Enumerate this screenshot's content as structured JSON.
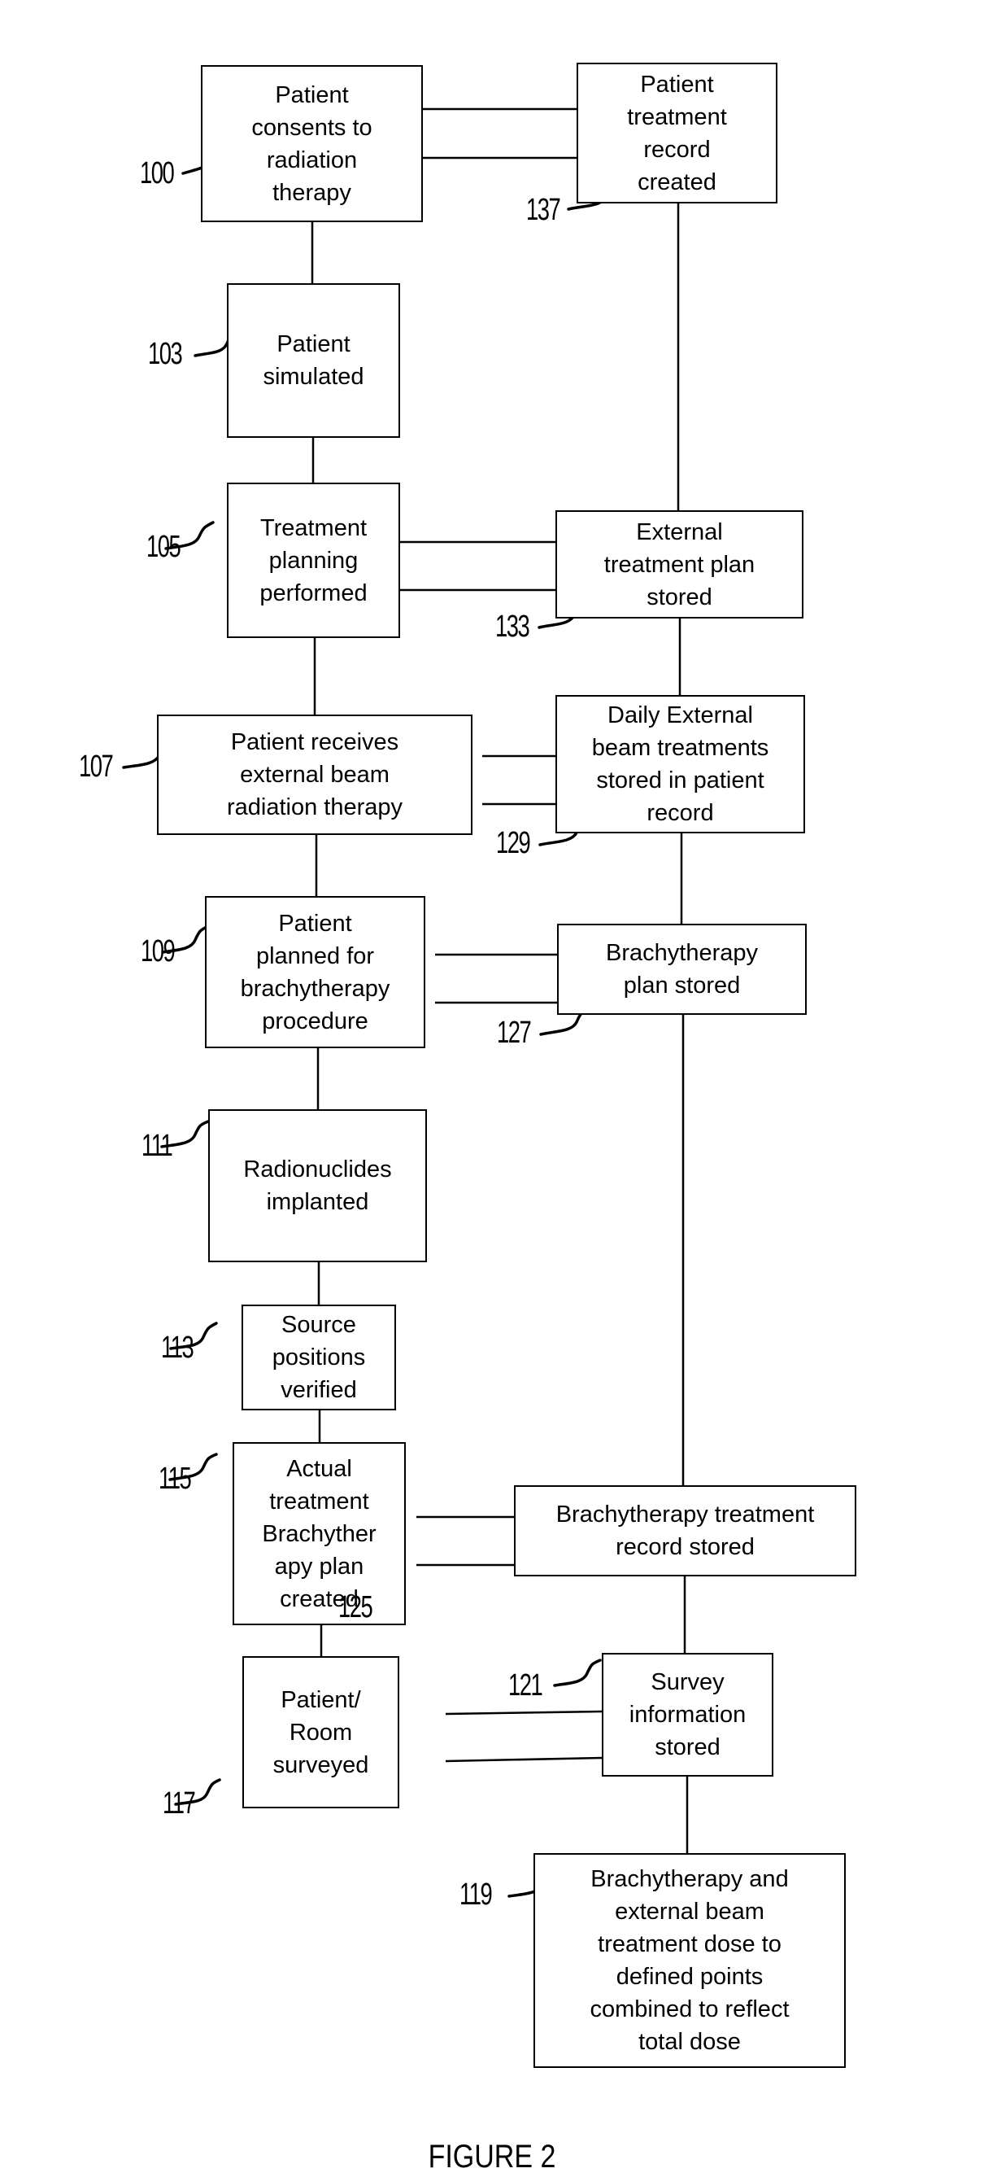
{
  "figure": {
    "caption": "FIGURE 2"
  },
  "steps": {
    "s100": {
      "ref": "100",
      "label": "Patient\nconsents to\nradiation\ntherapy"
    },
    "s103": {
      "ref": "103",
      "label": "Patient\nsimulated"
    },
    "s105": {
      "ref": "105",
      "label": "Treatment\nplanning\nperformed"
    },
    "s107": {
      "ref": "107",
      "label": "Patient receives\nexternal beam\nradiation therapy"
    },
    "s109": {
      "ref": "109",
      "label": "Patient\nplanned for\nbrachytherapy\nprocedure"
    },
    "s111": {
      "ref": "111",
      "label": "Radionuclides\nimplanted"
    },
    "s113": {
      "ref": "113",
      "label": "Source\npositions\nverified"
    },
    "s115": {
      "ref": "115",
      "label": "Actual\ntreatment\nBrachyther\napy plan\ncreated"
    },
    "s117": {
      "ref": "117",
      "label": "Patient/\nRoom\nsurveyed"
    }
  },
  "records": {
    "r137": {
      "ref": "137",
      "label": "Patient\ntreatment\nrecord\ncreated"
    },
    "r133": {
      "ref": "133",
      "label": "External\ntreatment plan\nstored"
    },
    "r129": {
      "ref": "129",
      "label": "Daily External\nbeam treatments\nstored in patient\nrecord"
    },
    "r127": {
      "ref": "127",
      "label": "Brachytherapy\nplan stored"
    },
    "r125": {
      "ref": "125",
      "label": "Brachytherapy treatment\nrecord stored"
    },
    "r121": {
      "ref": "121",
      "label": "Survey\ninformation\nstored"
    },
    "r119": {
      "ref": "119",
      "label": "Brachytherapy and\nexternal beam\ntreatment dose to\ndefined points\ncombined to reflect\ntotal dose"
    }
  }
}
